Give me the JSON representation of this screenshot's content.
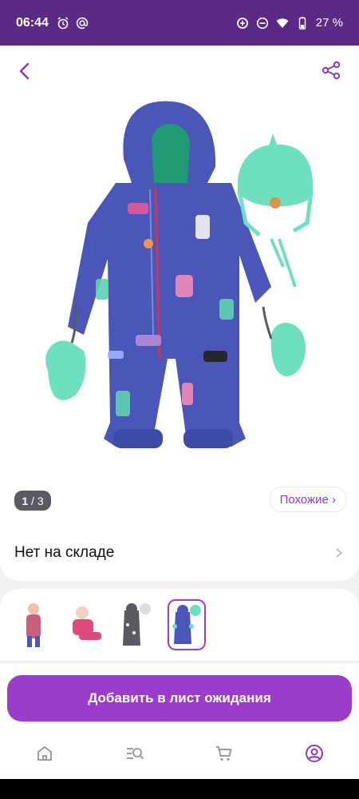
{
  "status_bar": {
    "time": "06:44",
    "battery": "27 %",
    "icons": [
      "alarm-icon",
      "at-icon",
      "data-saver-icon",
      "do-not-disturb-icon",
      "wifi-icon",
      "battery-icon"
    ]
  },
  "product": {
    "image_counter_current": "1",
    "image_counter_total": "/ 3",
    "similar_label": "Похожие ›",
    "stock_status": "Нет на складе",
    "image": "baby-snowsuit-with-cats",
    "thumbnails": [
      "child-in-snowsuit-standing",
      "child-in-pink-snowsuit-sitting",
      "gray-snowsuit-with-hat",
      "blue-snowsuit-with-hat"
    ],
    "active_thumbnail": 3
  },
  "actions": {
    "waitlist_button": "Добавить в лист ожидания"
  },
  "bottom_nav": [
    "home-icon",
    "catalog-search-icon",
    "cart-icon",
    "profile-icon"
  ],
  "colors": {
    "status_bar": "#5b2a86",
    "accent": "#9b3ccc",
    "snowsuit": "#4a57b8",
    "mint": "#6ee0c0"
  }
}
